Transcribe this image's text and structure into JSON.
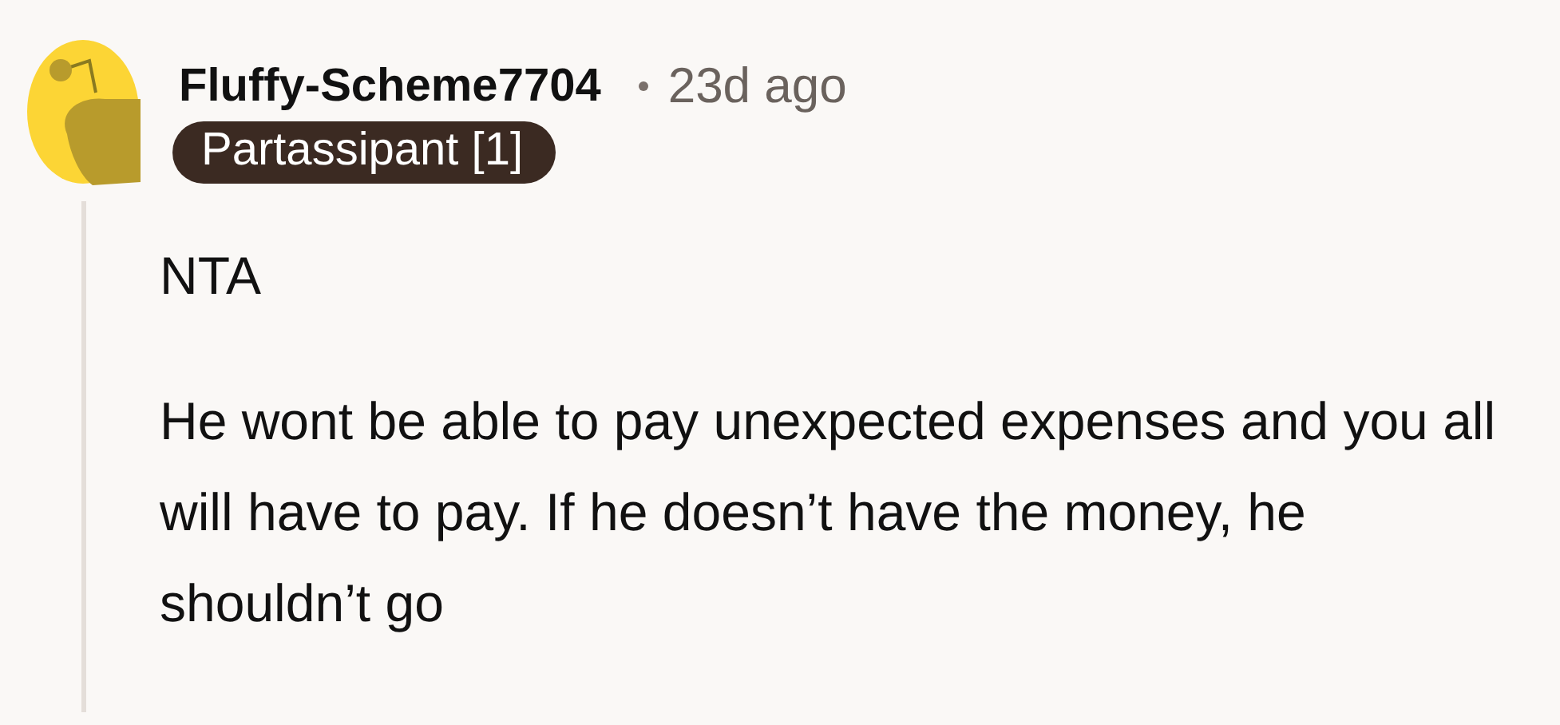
{
  "comment": {
    "author": "Fluffy-Scheme7704",
    "time": "23d ago",
    "flair": "Partassipant [1]",
    "paragraphs": [
      "NTA",
      "He wont be able to pay unexpected expenses and you all will have to pay. If he doesn’t have the money, he shouldn’t go"
    ]
  }
}
